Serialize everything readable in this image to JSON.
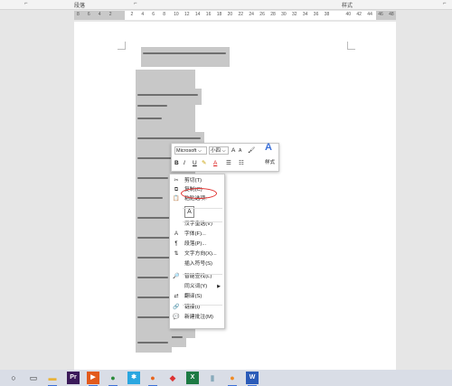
{
  "ribbon": {
    "paragraph_group": "段落",
    "styles_group": "样式"
  },
  "ruler": {
    "ticks": [
      "8",
      "6",
      "4",
      "2",
      "",
      "2",
      "4",
      "6",
      "8",
      "10",
      "12",
      "14",
      "16",
      "18",
      "20",
      "22",
      "24",
      "26",
      "28",
      "30",
      "32",
      "34",
      "36",
      "38",
      "",
      "40",
      "42",
      "44",
      "46",
      "48"
    ]
  },
  "document": {
    "lines": [
      "ཀ",
      "ཁ",
      "ག",
      "ང",
      "ཅ",
      "ཆ",
      "ཇ",
      "ཉ",
      "ཏ",
      "ཐ",
      "ད",
      "ན",
      "པ",
      "ཕ",
      "བ",
      "མ",
      "ཙ"
    ]
  },
  "mini_toolbar": {
    "font_name": "Microsoft",
    "font_size": "小四",
    "grow": "A",
    "shrink": "A",
    "bold": "B",
    "italic": "I",
    "underline": "U",
    "font_color": "A",
    "styles_label": "样式",
    "style_icon": "A"
  },
  "context_menu": {
    "items": [
      {
        "label": "剪切(T)",
        "icon": "scissors-icon"
      },
      {
        "label": "复制(C)",
        "icon": "copy-icon"
      },
      {
        "label": "粘贴选项:",
        "icon": "paste-icon"
      },
      {
        "label": "",
        "icon": "paste-text-icon"
      },
      {
        "label": "汉字重选(V)",
        "icon": ""
      },
      {
        "label": "字体(F)...",
        "icon": "font-icon"
      },
      {
        "label": "段落(P)...",
        "icon": "paragraph-icon"
      },
      {
        "label": "文字方向(X)...",
        "icon": "text-direction-icon"
      },
      {
        "label": "插入符号(S)",
        "icon": ""
      },
      {
        "label": "智能查找(L)",
        "icon": "search-icon"
      },
      {
        "label": "同义词(Y)",
        "icon": ""
      },
      {
        "label": "翻译(S)",
        "icon": "translate-icon"
      },
      {
        "label": "链接(I)",
        "icon": "link-icon"
      },
      {
        "label": "新建批注(M)",
        "icon": "comment-icon"
      }
    ]
  },
  "taskbar": {
    "apps": [
      "start",
      "task-view",
      "file-explorer",
      "premiere",
      "media-player",
      "chrome",
      "pinwheel",
      "firefox",
      "maps",
      "excel",
      "notes",
      "browser",
      "word"
    ]
  },
  "colors": {
    "accent": "#3a6fd8",
    "highlight": "#c8c8c8",
    "circle": "#e0312f"
  }
}
